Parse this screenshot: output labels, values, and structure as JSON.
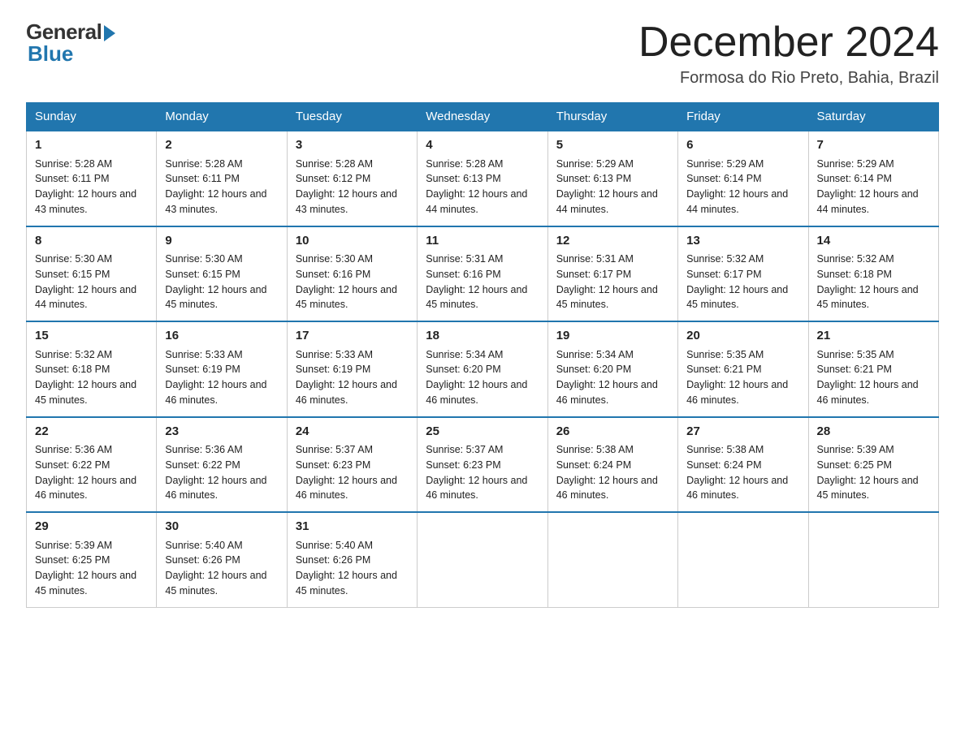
{
  "logo": {
    "general": "General",
    "blue": "Blue"
  },
  "title": "December 2024",
  "location": "Formosa do Rio Preto, Bahia, Brazil",
  "days_of_week": [
    "Sunday",
    "Monday",
    "Tuesday",
    "Wednesday",
    "Thursday",
    "Friday",
    "Saturday"
  ],
  "weeks": [
    [
      {
        "day": "1",
        "sunrise": "5:28 AM",
        "sunset": "6:11 PM",
        "daylight": "12 hours and 43 minutes."
      },
      {
        "day": "2",
        "sunrise": "5:28 AM",
        "sunset": "6:11 PM",
        "daylight": "12 hours and 43 minutes."
      },
      {
        "day": "3",
        "sunrise": "5:28 AM",
        "sunset": "6:12 PM",
        "daylight": "12 hours and 43 minutes."
      },
      {
        "day": "4",
        "sunrise": "5:28 AM",
        "sunset": "6:13 PM",
        "daylight": "12 hours and 44 minutes."
      },
      {
        "day": "5",
        "sunrise": "5:29 AM",
        "sunset": "6:13 PM",
        "daylight": "12 hours and 44 minutes."
      },
      {
        "day": "6",
        "sunrise": "5:29 AM",
        "sunset": "6:14 PM",
        "daylight": "12 hours and 44 minutes."
      },
      {
        "day": "7",
        "sunrise": "5:29 AM",
        "sunset": "6:14 PM",
        "daylight": "12 hours and 44 minutes."
      }
    ],
    [
      {
        "day": "8",
        "sunrise": "5:30 AM",
        "sunset": "6:15 PM",
        "daylight": "12 hours and 44 minutes."
      },
      {
        "day": "9",
        "sunrise": "5:30 AM",
        "sunset": "6:15 PM",
        "daylight": "12 hours and 45 minutes."
      },
      {
        "day": "10",
        "sunrise": "5:30 AM",
        "sunset": "6:16 PM",
        "daylight": "12 hours and 45 minutes."
      },
      {
        "day": "11",
        "sunrise": "5:31 AM",
        "sunset": "6:16 PM",
        "daylight": "12 hours and 45 minutes."
      },
      {
        "day": "12",
        "sunrise": "5:31 AM",
        "sunset": "6:17 PM",
        "daylight": "12 hours and 45 minutes."
      },
      {
        "day": "13",
        "sunrise": "5:32 AM",
        "sunset": "6:17 PM",
        "daylight": "12 hours and 45 minutes."
      },
      {
        "day": "14",
        "sunrise": "5:32 AM",
        "sunset": "6:18 PM",
        "daylight": "12 hours and 45 minutes."
      }
    ],
    [
      {
        "day": "15",
        "sunrise": "5:32 AM",
        "sunset": "6:18 PM",
        "daylight": "12 hours and 45 minutes."
      },
      {
        "day": "16",
        "sunrise": "5:33 AM",
        "sunset": "6:19 PM",
        "daylight": "12 hours and 46 minutes."
      },
      {
        "day": "17",
        "sunrise": "5:33 AM",
        "sunset": "6:19 PM",
        "daylight": "12 hours and 46 minutes."
      },
      {
        "day": "18",
        "sunrise": "5:34 AM",
        "sunset": "6:20 PM",
        "daylight": "12 hours and 46 minutes."
      },
      {
        "day": "19",
        "sunrise": "5:34 AM",
        "sunset": "6:20 PM",
        "daylight": "12 hours and 46 minutes."
      },
      {
        "day": "20",
        "sunrise": "5:35 AM",
        "sunset": "6:21 PM",
        "daylight": "12 hours and 46 minutes."
      },
      {
        "day": "21",
        "sunrise": "5:35 AM",
        "sunset": "6:21 PM",
        "daylight": "12 hours and 46 minutes."
      }
    ],
    [
      {
        "day": "22",
        "sunrise": "5:36 AM",
        "sunset": "6:22 PM",
        "daylight": "12 hours and 46 minutes."
      },
      {
        "day": "23",
        "sunrise": "5:36 AM",
        "sunset": "6:22 PM",
        "daylight": "12 hours and 46 minutes."
      },
      {
        "day": "24",
        "sunrise": "5:37 AM",
        "sunset": "6:23 PM",
        "daylight": "12 hours and 46 minutes."
      },
      {
        "day": "25",
        "sunrise": "5:37 AM",
        "sunset": "6:23 PM",
        "daylight": "12 hours and 46 minutes."
      },
      {
        "day": "26",
        "sunrise": "5:38 AM",
        "sunset": "6:24 PM",
        "daylight": "12 hours and 46 minutes."
      },
      {
        "day": "27",
        "sunrise": "5:38 AM",
        "sunset": "6:24 PM",
        "daylight": "12 hours and 46 minutes."
      },
      {
        "day": "28",
        "sunrise": "5:39 AM",
        "sunset": "6:25 PM",
        "daylight": "12 hours and 45 minutes."
      }
    ],
    [
      {
        "day": "29",
        "sunrise": "5:39 AM",
        "sunset": "6:25 PM",
        "daylight": "12 hours and 45 minutes."
      },
      {
        "day": "30",
        "sunrise": "5:40 AM",
        "sunset": "6:26 PM",
        "daylight": "12 hours and 45 minutes."
      },
      {
        "day": "31",
        "sunrise": "5:40 AM",
        "sunset": "6:26 PM",
        "daylight": "12 hours and 45 minutes."
      },
      null,
      null,
      null,
      null
    ]
  ],
  "labels": {
    "sunrise": "Sunrise:",
    "sunset": "Sunset:",
    "daylight": "Daylight:"
  }
}
